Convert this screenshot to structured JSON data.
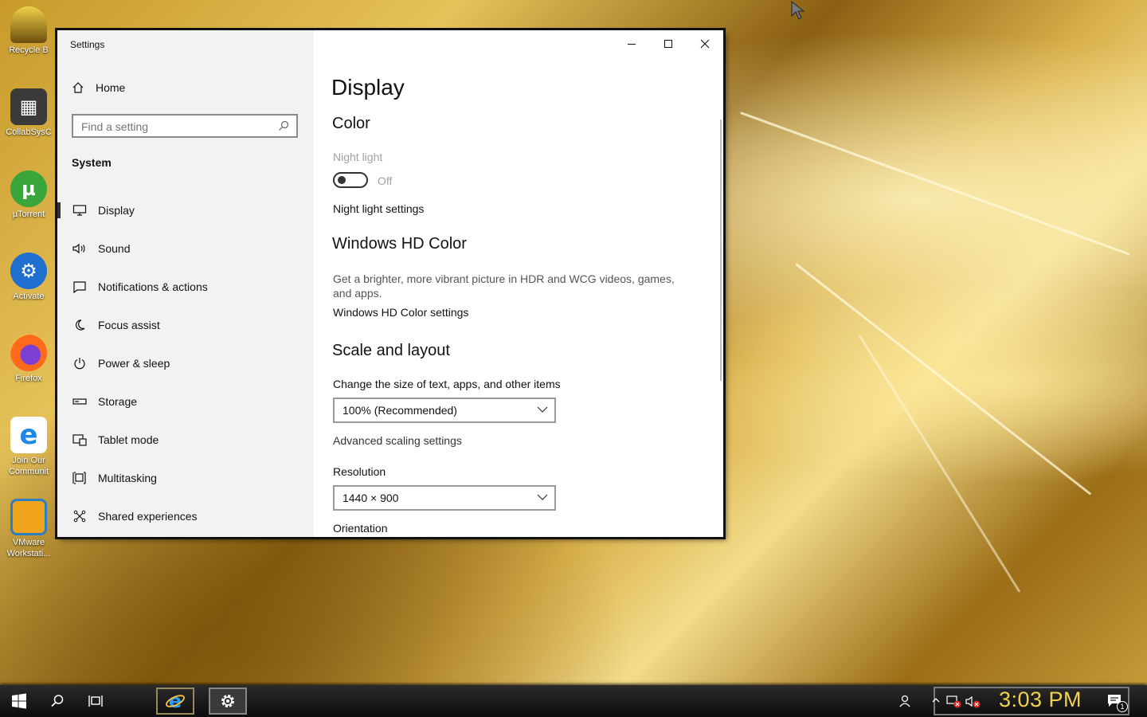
{
  "desktop": {
    "icons": [
      {
        "label": "Recycle B",
        "icon": "recycle-bin-icon"
      },
      {
        "label": "CollabSysC",
        "icon": "folder-icon"
      },
      {
        "label": "µTorrent",
        "icon": "utorrent-icon"
      },
      {
        "label": "Activate",
        "icon": "activator-icon"
      },
      {
        "label": "Firefox",
        "icon": "firefox-icon"
      },
      {
        "label": "Join Our\nCommunit",
        "icon": "internet-explorer-icon"
      },
      {
        "label": "VMware\nWorkstati...",
        "icon": "vmware-icon"
      }
    ]
  },
  "window": {
    "title": "Settings",
    "controls": {
      "minimize": "minimize-icon",
      "maximize": "maximize-icon",
      "close": "close-icon"
    }
  },
  "sidebar": {
    "home_label": "Home",
    "search_placeholder": "Find a setting",
    "group_title": "System",
    "items": [
      {
        "label": "Display",
        "icon": "monitor-icon",
        "active": true
      },
      {
        "label": "Sound",
        "icon": "speaker-icon"
      },
      {
        "label": "Notifications & actions",
        "icon": "notification-icon"
      },
      {
        "label": "Focus assist",
        "icon": "moon-icon"
      },
      {
        "label": "Power & sleep",
        "icon": "power-icon"
      },
      {
        "label": "Storage",
        "icon": "storage-icon"
      },
      {
        "label": "Tablet mode",
        "icon": "tablet-icon"
      },
      {
        "label": "Multitasking",
        "icon": "multitasking-icon"
      },
      {
        "label": "Shared experiences",
        "icon": "shared-icon"
      }
    ]
  },
  "content": {
    "page_title": "Display",
    "color_heading": "Color",
    "night_light_label": "Night light",
    "night_light_state": "Off",
    "night_light_settings": "Night light settings",
    "hd_heading": "Windows HD Color",
    "hd_desc": "Get a brighter, more vibrant picture in HDR and WCG videos, games, and apps.",
    "hd_settings": "Windows HD Color settings",
    "scale_heading": "Scale and layout",
    "scale_label": "Change the size of text, apps, and other items",
    "scale_value": "100% (Recommended)",
    "advanced_scaling": "Advanced scaling settings",
    "resolution_label": "Resolution",
    "resolution_value": "1440 × 900",
    "orientation_label": "Orientation"
  },
  "taskbar": {
    "clock": "3:03 PM",
    "notification_count": "1",
    "colors": {
      "clock": "#f3d24a"
    }
  }
}
